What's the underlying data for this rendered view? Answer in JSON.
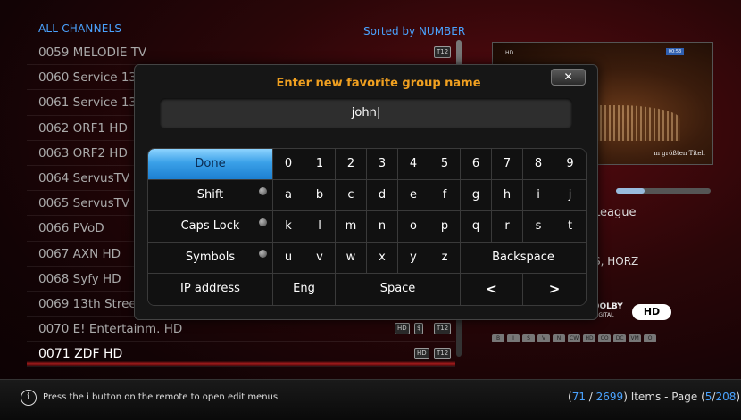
{
  "header": {
    "list_title": "ALL CHANNELS",
    "sort_label": "Sorted by NUMBER"
  },
  "channels": [
    {
      "label": "0059  MELODIE TV",
      "badges": [
        "T12"
      ]
    },
    {
      "label": "0060  Service 13",
      "badges": []
    },
    {
      "label": "0061  Service 13",
      "badges": []
    },
    {
      "label": "0062  ORF1 HD",
      "badges": []
    },
    {
      "label": "0063  ORF2 HD",
      "badges": []
    },
    {
      "label": "0064  ServusTV",
      "badges": []
    },
    {
      "label": "0065  ServusTV",
      "badges": []
    },
    {
      "label": "0066  PVoD",
      "badges": []
    },
    {
      "label": "0067  AXN HD",
      "badges": []
    },
    {
      "label": "0068  Syfy HD",
      "badges": []
    },
    {
      "label": "0069  13th Stree",
      "badges": []
    },
    {
      "label": "0070  E! Entertainm. HD",
      "badges": [
        "HD",
        "$",
        "T12"
      ]
    },
    {
      "label": "0071  ZDF HD",
      "badges": [
        "HD",
        "T12"
      ],
      "selected": true
    }
  ],
  "preview": {
    "caption": "m größten Titel,",
    "channel_logo": "HD",
    "clock": "00:53"
  },
  "event": {
    "progress_fraction": 0.3,
    "title_fragment": "League",
    "tech_fragment": "S, HORZ",
    "audio": "DOLBY",
    "audio_sub": "DIGITAL",
    "hd_badge": "HD",
    "feature_icons": [
      "B",
      "I",
      "S",
      "V",
      "N",
      "CW",
      "HD",
      "CO",
      "DC",
      "VM",
      "O"
    ]
  },
  "dialog": {
    "title": "Enter new favorite group name",
    "close_label": "✕",
    "input_value": "john|",
    "keys": {
      "done": "Done",
      "shift": "Shift",
      "caps": "Caps Lock",
      "symbols": "Symbols",
      "ip": "IP address",
      "eng": "Eng",
      "space": "Space",
      "backspace": "Backspace",
      "left": "<",
      "right": ">",
      "row1": [
        "0",
        "1",
        "2",
        "3",
        "4",
        "5",
        "6",
        "7",
        "8",
        "9"
      ],
      "row2": [
        "a",
        "b",
        "c",
        "d",
        "e",
        "f",
        "g",
        "h",
        "i",
        "j"
      ],
      "row3": [
        "k",
        "l",
        "m",
        "n",
        "o",
        "p",
        "q",
        "r",
        "s",
        "t"
      ],
      "row4": [
        "u",
        "v",
        "w",
        "x",
        "y",
        "z"
      ]
    }
  },
  "footer": {
    "hint": "Press the i button on the remote to open edit menus",
    "current": "71",
    "total": "2699",
    "items_label": "Items - Page",
    "page_current": "5",
    "page_total": "208"
  }
}
